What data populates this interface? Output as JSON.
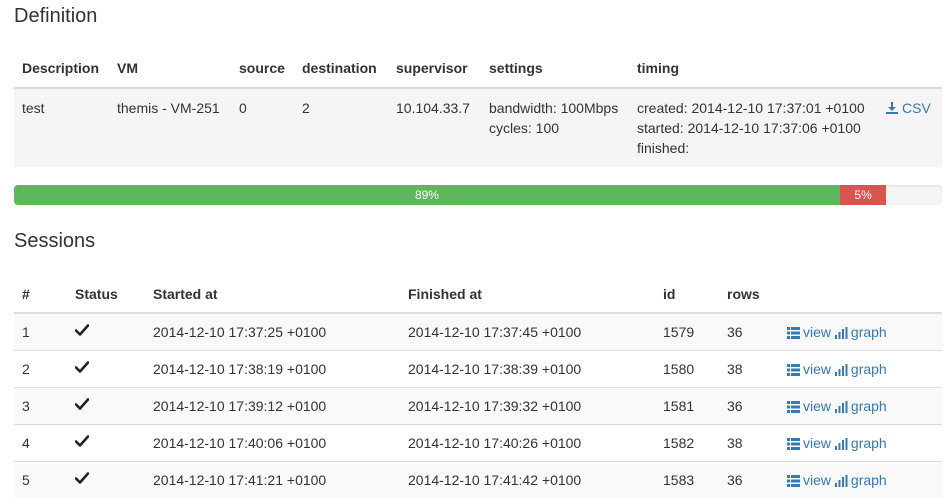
{
  "definition": {
    "title": "Definition",
    "headers": {
      "description": "Description",
      "vm": "VM",
      "source": "source",
      "destination": "destination",
      "supervisor": "supervisor",
      "settings": "settings",
      "timing": "timing"
    },
    "row": {
      "description": "test",
      "vm": "themis - VM-251",
      "source": "0",
      "destination": "2",
      "supervisor": "10.104.33.7",
      "settings": [
        "bandwidth: 100Mbps",
        "cycles: 100"
      ],
      "timing": [
        "created: 2014-12-10 17:37:01 +0100",
        "started: 2014-12-10 17:37:06 +0100",
        "finished:"
      ],
      "csv_label": "CSV",
      "csv_icon": "download-icon"
    }
  },
  "progress": {
    "success_value": 0.89,
    "success_label": "89%",
    "success_color": "#5cb85c",
    "danger_value": 0.05,
    "danger_label": "5%",
    "danger_color": "#d9534f"
  },
  "sessions": {
    "title": "Sessions",
    "headers": {
      "num": "#",
      "status": "Status",
      "started": "Started at",
      "finished": "Finished at",
      "id": "id",
      "rows": "rows"
    },
    "view_label": "view",
    "graph_label": "graph",
    "status_icon": "check-icon",
    "rows": [
      {
        "num": "1",
        "started": "2014-12-10 17:37:25 +0100",
        "finished": "2014-12-10 17:37:45 +0100",
        "id": "1579",
        "rows": "36"
      },
      {
        "num": "2",
        "started": "2014-12-10 17:38:19 +0100",
        "finished": "2014-12-10 17:38:39 +0100",
        "id": "1580",
        "rows": "38"
      },
      {
        "num": "3",
        "started": "2014-12-10 17:39:12 +0100",
        "finished": "2014-12-10 17:39:32 +0100",
        "id": "1581",
        "rows": "36"
      },
      {
        "num": "4",
        "started": "2014-12-10 17:40:06 +0100",
        "finished": "2014-12-10 17:40:26 +0100",
        "id": "1582",
        "rows": "38"
      },
      {
        "num": "5",
        "started": "2014-12-10 17:41:21 +0100",
        "finished": "2014-12-10 17:41:42 +0100",
        "id": "1583",
        "rows": "36"
      }
    ]
  },
  "colors": {
    "link": "#337ab7",
    "stripe": "#f9f9f9",
    "definition_row_bg": "#f5f5f5"
  }
}
